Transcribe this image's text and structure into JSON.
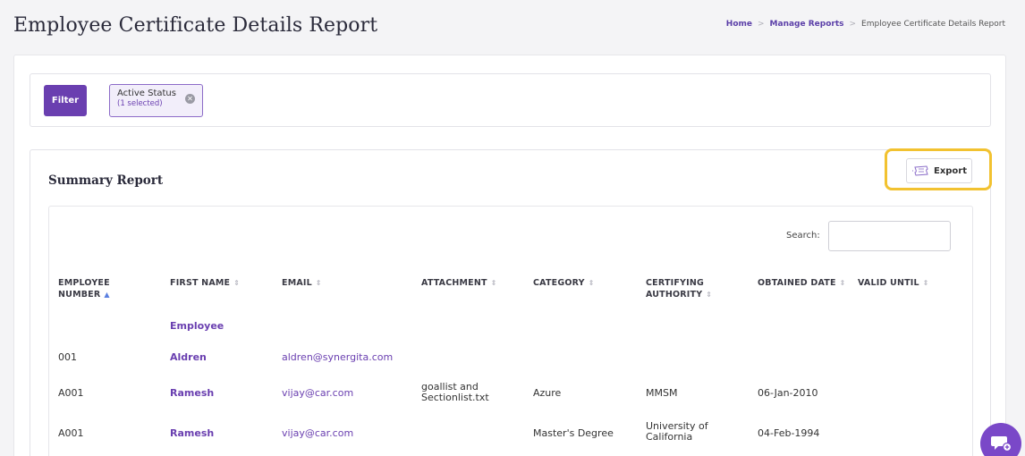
{
  "page": {
    "title": "Employee Certificate Details Report"
  },
  "breadcrumb": {
    "items": [
      "Home",
      "Manage Reports",
      "Employee Certificate Details Report"
    ]
  },
  "filter": {
    "button_label": "Filter",
    "chip_title": "Active Status",
    "chip_subtitle": "(1 selected)"
  },
  "summary": {
    "title": "Summary Report",
    "export_label": "Export",
    "search_label": "Search:",
    "search_value": ""
  },
  "table": {
    "columns": [
      {
        "label": "EMPLOYEE NUMBER",
        "sort": "asc"
      },
      {
        "label": "FIRST NAME",
        "sort": "none"
      },
      {
        "label": "EMAIL",
        "sort": "none"
      },
      {
        "label": "ATTACHMENT",
        "sort": "none"
      },
      {
        "label": "CATEGORY",
        "sort": "none"
      },
      {
        "label": "CERTIFYING AUTHORITY",
        "sort": "none"
      },
      {
        "label": "OBTAINED DATE",
        "sort": "none"
      },
      {
        "label": "VALID UNTIL",
        "sort": "none"
      }
    ],
    "rows": [
      {
        "employee_number": "",
        "first_name": "Employee",
        "email": "",
        "attachment": "",
        "category": "",
        "certifying_authority": "",
        "obtained_date": "",
        "valid_until": ""
      },
      {
        "employee_number": "001",
        "first_name": "Aldren",
        "email": "aldren@synergita.com",
        "attachment": "",
        "category": "",
        "certifying_authority": "",
        "obtained_date": "",
        "valid_until": ""
      },
      {
        "employee_number": "A001",
        "first_name": "Ramesh",
        "email": "vijay@car.com",
        "attachment": "goallist and Sectionlist.txt",
        "category": "Azure",
        "certifying_authority": "MMSM",
        "obtained_date": "06-Jan-2010",
        "valid_until": ""
      },
      {
        "employee_number": "A001",
        "first_name": "Ramesh",
        "email": "vijay@car.com",
        "attachment": "",
        "category": "Master's Degree",
        "certifying_authority": "University of California",
        "obtained_date": "04-Feb-1994",
        "valid_until": ""
      }
    ]
  },
  "icons": {
    "export": "ticket-icon",
    "chip_close": "close-circle-icon",
    "chat": "chat-bubble-icon"
  },
  "colors": {
    "accent": "#6a3fb0",
    "highlight": "#f2c230"
  }
}
